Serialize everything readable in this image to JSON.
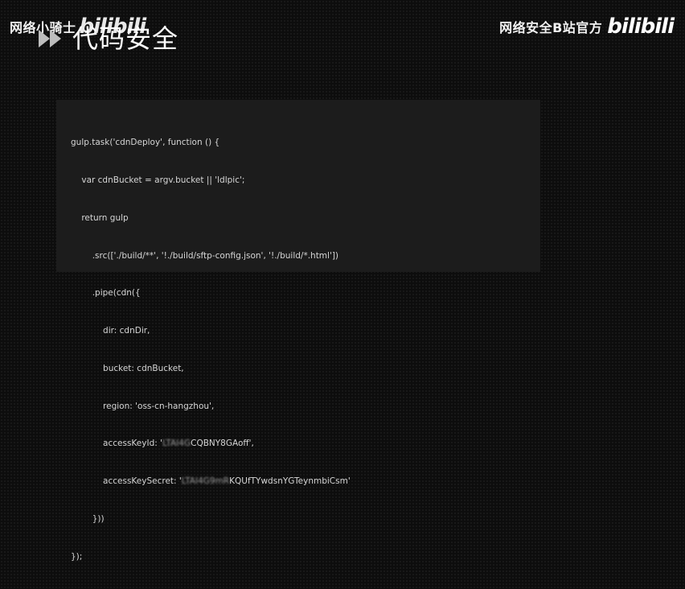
{
  "watermark_left": {
    "channel_name": "网络小骑士",
    "logo": "bilibili"
  },
  "watermark_right": {
    "channel_name": "网络安全B站官方",
    "logo": "bilibili"
  },
  "header": {
    "icon": "fast-forward-icon",
    "title": "代码安全"
  },
  "code": {
    "lines": [
      "gulp.task('cdnDeploy', function () {",
      "    var cdnBucket = argv.bucket || 'ldlpic';",
      "    return gulp",
      "        .src(['./build/**', '!./build/sftp-config.json', '!./build/*.html'])",
      "        .pipe(cdn({",
      "            dir: cdnDir,",
      "            bucket: cdnBucket,",
      "            region: 'oss-cn-hangzhou',",
      "            accessKeyId: '",
      "            accessKeySecret: '",
      "        }))",
      "});"
    ],
    "access_key_id_masked": "LTAI4G",
    "access_key_id_tail": "CQBNY8GAoff',",
    "access_key_secret_masked": "LTAI4G9mR",
    "access_key_secret_tail": "KQUfTYwdsnYGTeynmbiCsm'"
  },
  "colors": {
    "background": "#0d0d0d",
    "code_panel": "#1c1c1c",
    "code_text": "#d6d6d6",
    "title_text": "#ffffff",
    "icon": "#bdbdbd"
  }
}
